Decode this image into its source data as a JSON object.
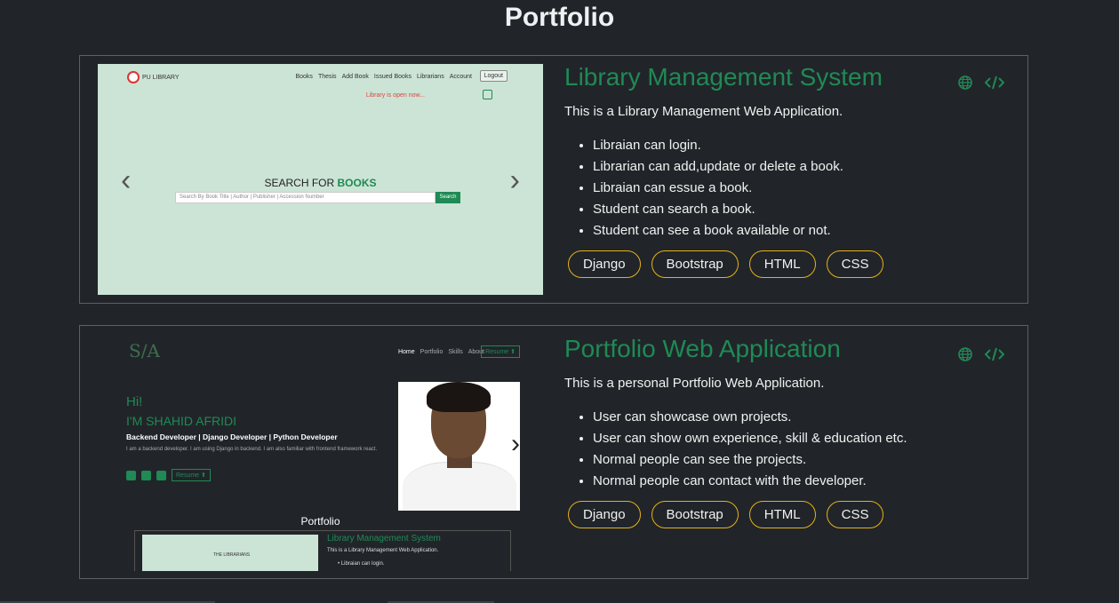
{
  "page": {
    "title": "Portfolio"
  },
  "projects": [
    {
      "title": "Library Management System",
      "description": "This is a Library Management Web Application.",
      "features": [
        "Libraian can login.",
        "Librarian can add,update or delete a book.",
        "Libraian can essue a book.",
        "Student can search a book.",
        "Student can see a book available or not."
      ],
      "tags": [
        "Django",
        "Bootstrap",
        "HTML",
        "CSS"
      ],
      "icons": [
        "globe-icon",
        "code-icon"
      ]
    },
    {
      "title": "Portfolio Web Application",
      "description": "This is a personal Portfolio Web Application.",
      "features": [
        "User can showcase own projects.",
        "User can show own experience, skill & education etc.",
        "Normal people can see the projects.",
        "Normal people can contact with the developer."
      ],
      "tags": [
        "Django",
        "Bootstrap",
        "HTML",
        "CSS"
      ],
      "icons": [
        "globe-icon",
        "code-icon"
      ]
    }
  ],
  "lib_shot": {
    "logo": "PU LIBRARY",
    "nav": [
      "Books",
      "Thesis",
      "Add Book",
      "Issued Books",
      "Librarians",
      "Account"
    ],
    "logout": "Logout",
    "status": "Library is open now...",
    "search_title_a": "SEARCH FOR ",
    "search_title_b": "BOOKS",
    "search_placeholder": "Search By Book Title | Author | Publisher | Accession Number",
    "search_button": "Search"
  },
  "pf_shot": {
    "logo": "S/A",
    "nav": [
      "Home",
      "Portfolio",
      "Skills",
      "About"
    ],
    "resume": "Resume",
    "hi": "Hi!",
    "name": "I'M SHAHID AFRIDI",
    "role": "Backend Developer | Django Developer | Python Developer",
    "bio": "I am a backend developer. I am using Django in backend. I am also familiar with frontend framework react.",
    "section": "Portfolio",
    "mini_title": "Library Management System",
    "mini_desc": "This is a Library Management Web Application.",
    "mini_li": "Libraian can login.",
    "mini_lib": "THE LIBRARIANS"
  },
  "colors": {
    "accent": "#1f8a55",
    "tag_border": "#e5b119",
    "background": "#212529"
  }
}
